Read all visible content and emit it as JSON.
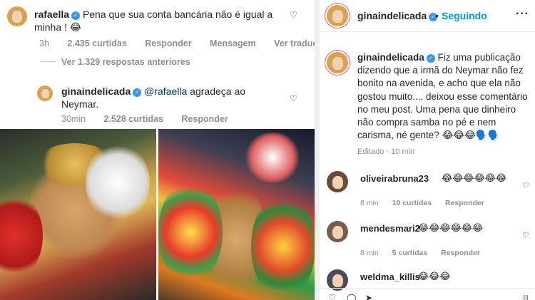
{
  "left": {
    "comment1": {
      "username": "rafaella",
      "text": "Pena que sua conta bancária não é igual a minha ! 😂",
      "time": "3h",
      "likes": "2.435 curtidas",
      "reply": "Responder",
      "message": "Mensagem",
      "translate": "Ver traduç..."
    },
    "view_more": "Ver 1.329 respostas anteriores",
    "comment2": {
      "username": "ginaindelicada",
      "mention": "@rafaella",
      "text": " agradeça ao Neymar.",
      "time": "30min",
      "likes": "2.528 curtidas",
      "reply": "Responder"
    }
  },
  "right": {
    "header": {
      "username": "ginaindelicada",
      "dot": "•",
      "follow": "Seguindo",
      "more": "···"
    },
    "caption": {
      "username": "ginaindelicada",
      "text": "Fiz uma publicação dizendo que a irmã do Neymar não fez bonito na avenida, e acho que ela não gostou muito.... deixou esse comentário no meu post. Uma pena que dinheiro não compra samba no pé e nem carisma, né gente? 😂😂😂🗣️🗣️",
      "meta": "Editado · 10 min"
    },
    "comments": [
      {
        "username": "oliveirabruna23",
        "emojis": "😂😂😂😂😂😂",
        "time": "8 min",
        "likes": "10 curtidas",
        "reply": "Responder"
      },
      {
        "username": "mendesmari2",
        "emojis": "😂😂😂😂😂😂",
        "time": "8 min",
        "likes": "5 curtidas",
        "reply": "Responder"
      },
      {
        "username": "weldma_killis",
        "emojis": "😂😂😂",
        "time": "",
        "likes": "",
        "reply": ""
      }
    ]
  },
  "colors": {
    "link": "#0095f6",
    "mention": "#00376b",
    "muted": "#8e8e8e",
    "verified": "#3897f0"
  },
  "icons": [
    "heart-icon",
    "verified-icon",
    "more-options-icon",
    "bookmark-icon",
    "comment-icon",
    "share-icon"
  ]
}
